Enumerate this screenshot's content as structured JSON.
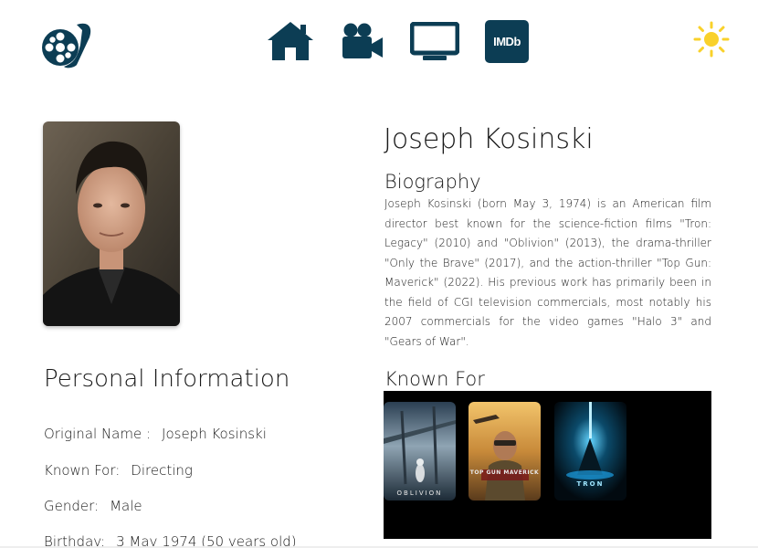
{
  "header": {
    "logo": "film-reel-logo",
    "nav": [
      {
        "icon": "home-icon"
      },
      {
        "icon": "movie-camera-icon"
      },
      {
        "icon": "tv-icon"
      },
      {
        "icon": "imdb-icon",
        "label": "IMDb"
      }
    ],
    "theme_icon": "sun-icon",
    "accent_color": "#0c3d54",
    "sun_color": "#f9d12a"
  },
  "person": {
    "name": "Joseph Kosinski",
    "biography_title": "Biography",
    "biography": "Joseph Kosinski (born May 3, 1974) is an American film director best known for the science-fiction films \"Tron: Legacy\" (2010) and \"Oblivion\" (2013), the drama-thriller \"Only the Brave\" (2017), and the action-thriller \"Top Gun: Maverick\" (2022). His previous work has primarily been in the field of CGI television commercials, most notably his 2007 commercials for the video games \"Halo 3\" and \"Gears of War\"."
  },
  "personal_info": {
    "title": "Personal Information",
    "rows": [
      {
        "label": "Original Name :",
        "value": "Joseph Kosinski"
      },
      {
        "label": "Known For:",
        "value": "Directing"
      },
      {
        "label": "Gender:",
        "value": "Male"
      },
      {
        "label": "Birthday:",
        "value": "3 May 1974 (50 years old)"
      }
    ]
  },
  "known_for": {
    "title": "Known For",
    "posters": [
      {
        "title": "OBLIVION"
      },
      {
        "title": "TOP GUN MAVERICK"
      },
      {
        "title": "TRON"
      }
    ]
  }
}
